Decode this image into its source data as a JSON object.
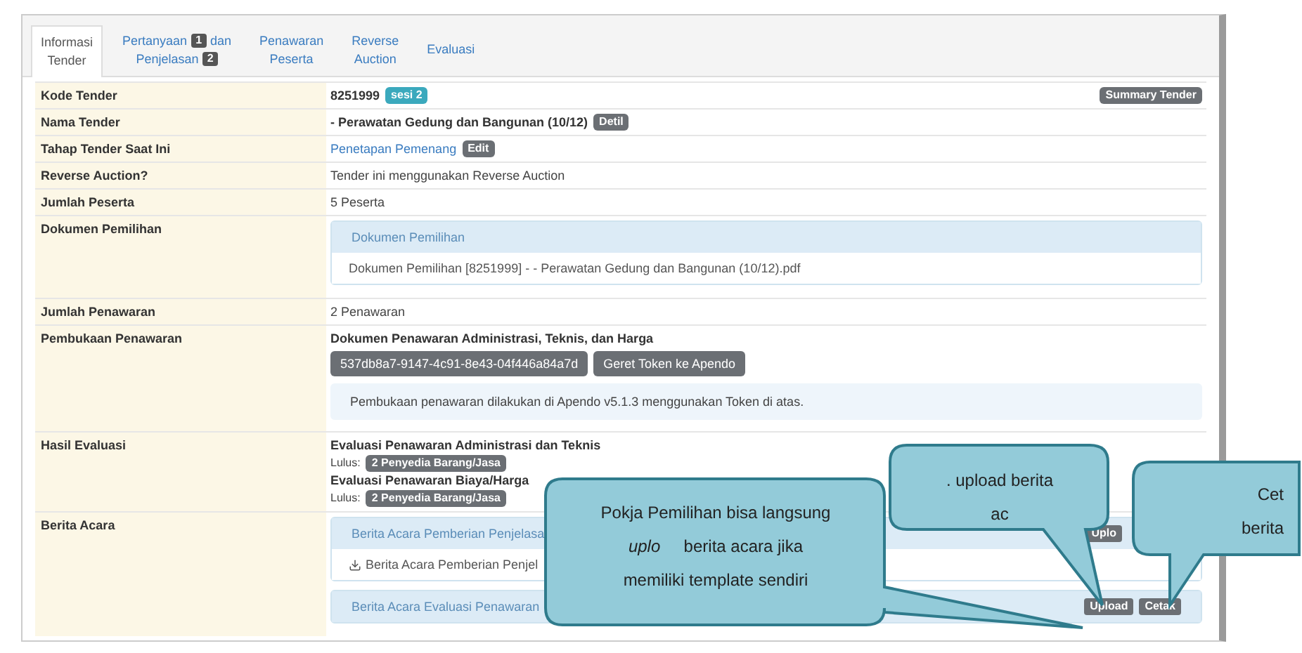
{
  "tabs": [
    {
      "selected": true,
      "lines": [
        [
          {
            "kind": "text",
            "text": "Informasi"
          }
        ],
        [
          {
            "kind": "text",
            "text": "Tender"
          }
        ]
      ]
    },
    {
      "selected": false,
      "lines": [
        [
          {
            "kind": "text",
            "text": "Pertanyaan"
          },
          {
            "kind": "badge",
            "text": "1"
          },
          {
            "kind": "text",
            "text": "dan"
          }
        ],
        [
          {
            "kind": "text",
            "text": "Penjelasan"
          },
          {
            "kind": "badge",
            "text": "2"
          }
        ]
      ]
    },
    {
      "selected": false,
      "lines": [
        [
          {
            "kind": "text",
            "text": "Penawaran"
          }
        ],
        [
          {
            "kind": "text",
            "text": "Peserta"
          }
        ]
      ]
    },
    {
      "selected": false,
      "lines": [
        [
          {
            "kind": "text",
            "text": "Reverse"
          }
        ],
        [
          {
            "kind": "text",
            "text": "Auction"
          }
        ]
      ]
    },
    {
      "selected": false,
      "lines": [
        [
          {
            "kind": "text",
            "text": "Evaluasi"
          }
        ]
      ]
    }
  ],
  "rows": [
    {
      "label": "Kode Tender",
      "blocks": [
        {
          "kind": "line",
          "parts": [
            {
              "kind": "bold",
              "text": "8251999"
            },
            {
              "kind": "badge",
              "text": "sesi 2",
              "color": "#3ba9bd"
            }
          ],
          "right": "Summary Tender"
        }
      ]
    },
    {
      "label": "Nama Tender",
      "blocks": [
        {
          "kind": "line",
          "parts": [
            {
              "kind": "bold",
              "text": "- Perawatan Gedung dan Bangunan (10/12)"
            },
            {
              "kind": "badge",
              "text": "Detil",
              "color": "#6b6f74"
            }
          ]
        }
      ]
    },
    {
      "label": "Tahap Tender Saat Ini",
      "blocks": [
        {
          "kind": "line",
          "parts": [
            {
              "kind": "link",
              "text": "Penetapan Pemenang"
            },
            {
              "kind": "badge",
              "text": "Edit",
              "color": "#6b6f74"
            }
          ]
        }
      ]
    },
    {
      "label": "Reverse Auction?",
      "blocks": [
        {
          "kind": "line",
          "parts": [
            {
              "kind": "text",
              "text": "Tender ini menggunakan Reverse Auction"
            }
          ]
        }
      ]
    },
    {
      "label": "Jumlah Peserta",
      "blocks": [
        {
          "kind": "line",
          "parts": [
            {
              "kind": "text",
              "text": "5 Peserta"
            }
          ]
        }
      ]
    },
    {
      "label": "Dokumen Pemilihan",
      "blocks": [
        {
          "kind": "panel",
          "heading": "Dokumen Pemilihan",
          "body": [
            {
              "text": "Dokumen Pemilihan [8251999] - - Perawatan Gedung dan Bangunan (10/12).pdf",
              "download": false
            }
          ]
        }
      ]
    },
    {
      "label": "Jumlah Penawaran",
      "blocks": [
        {
          "kind": "line",
          "parts": [
            {
              "kind": "text",
              "text": "2 Penawaran"
            }
          ]
        }
      ]
    },
    {
      "label": "Pembukaan Penawaran",
      "blocks": [
        {
          "kind": "line",
          "parts": [
            {
              "kind": "bold",
              "text": "Dokumen Penawaran Administrasi, Teknis, dan Harga"
            }
          ]
        },
        {
          "kind": "buttons",
          "items": [
            "537db8a7-9147-4c91-8e43-04f446a84a7d",
            "Geret Token ke Apendo"
          ]
        },
        {
          "kind": "note",
          "text": "Pembukaan penawaran dilakukan di Apendo v5.1.3 menggunakan Token di atas."
        }
      ]
    },
    {
      "label": "Hasil Evaluasi",
      "blocks": [
        {
          "kind": "line",
          "parts": [
            {
              "kind": "bold",
              "text": "Evaluasi Penawaran Administrasi dan Teknis"
            }
          ]
        },
        {
          "kind": "line",
          "small": true,
          "parts": [
            {
              "kind": "text",
              "text": "Lulus:"
            },
            {
              "kind": "badge",
              "text": "2 Penyedia Barang/Jasa",
              "color": "#6b6f74"
            }
          ]
        },
        {
          "kind": "line",
          "parts": [
            {
              "kind": "bold",
              "text": "Evaluasi Penawaran Biaya/Harga"
            }
          ]
        },
        {
          "kind": "line",
          "small": true,
          "parts": [
            {
              "kind": "text",
              "text": "Lulus:"
            },
            {
              "kind": "badge",
              "text": "2 Penyedia Barang/Jasa",
              "color": "#6b6f74"
            }
          ]
        }
      ]
    },
    {
      "label": "Berita Acara",
      "blocks": [
        {
          "kind": "panel",
          "heading": "Berita Acara Pemberian Penjelasa",
          "actions": [
            "Uplo"
          ],
          "body": [
            {
              "text": "Berita Acara Pemberian Penjel",
              "download": true
            }
          ]
        },
        {
          "kind": "panel",
          "heading": "Berita Acara Evaluasi Penawaran",
          "actions": [
            "Upload",
            "Cetak"
          ]
        }
      ]
    }
  ],
  "callouts": [
    {
      "lines": [
        "Pokja Pemilihan bisa langsung",
        "*uplo*     berita acara jika",
        "memiliki template sendiri"
      ]
    },
    {
      "lines": [
        ". upload berita",
        "ac"
      ]
    },
    {
      "lines": [
        "Cet",
        "berita"
      ]
    }
  ]
}
